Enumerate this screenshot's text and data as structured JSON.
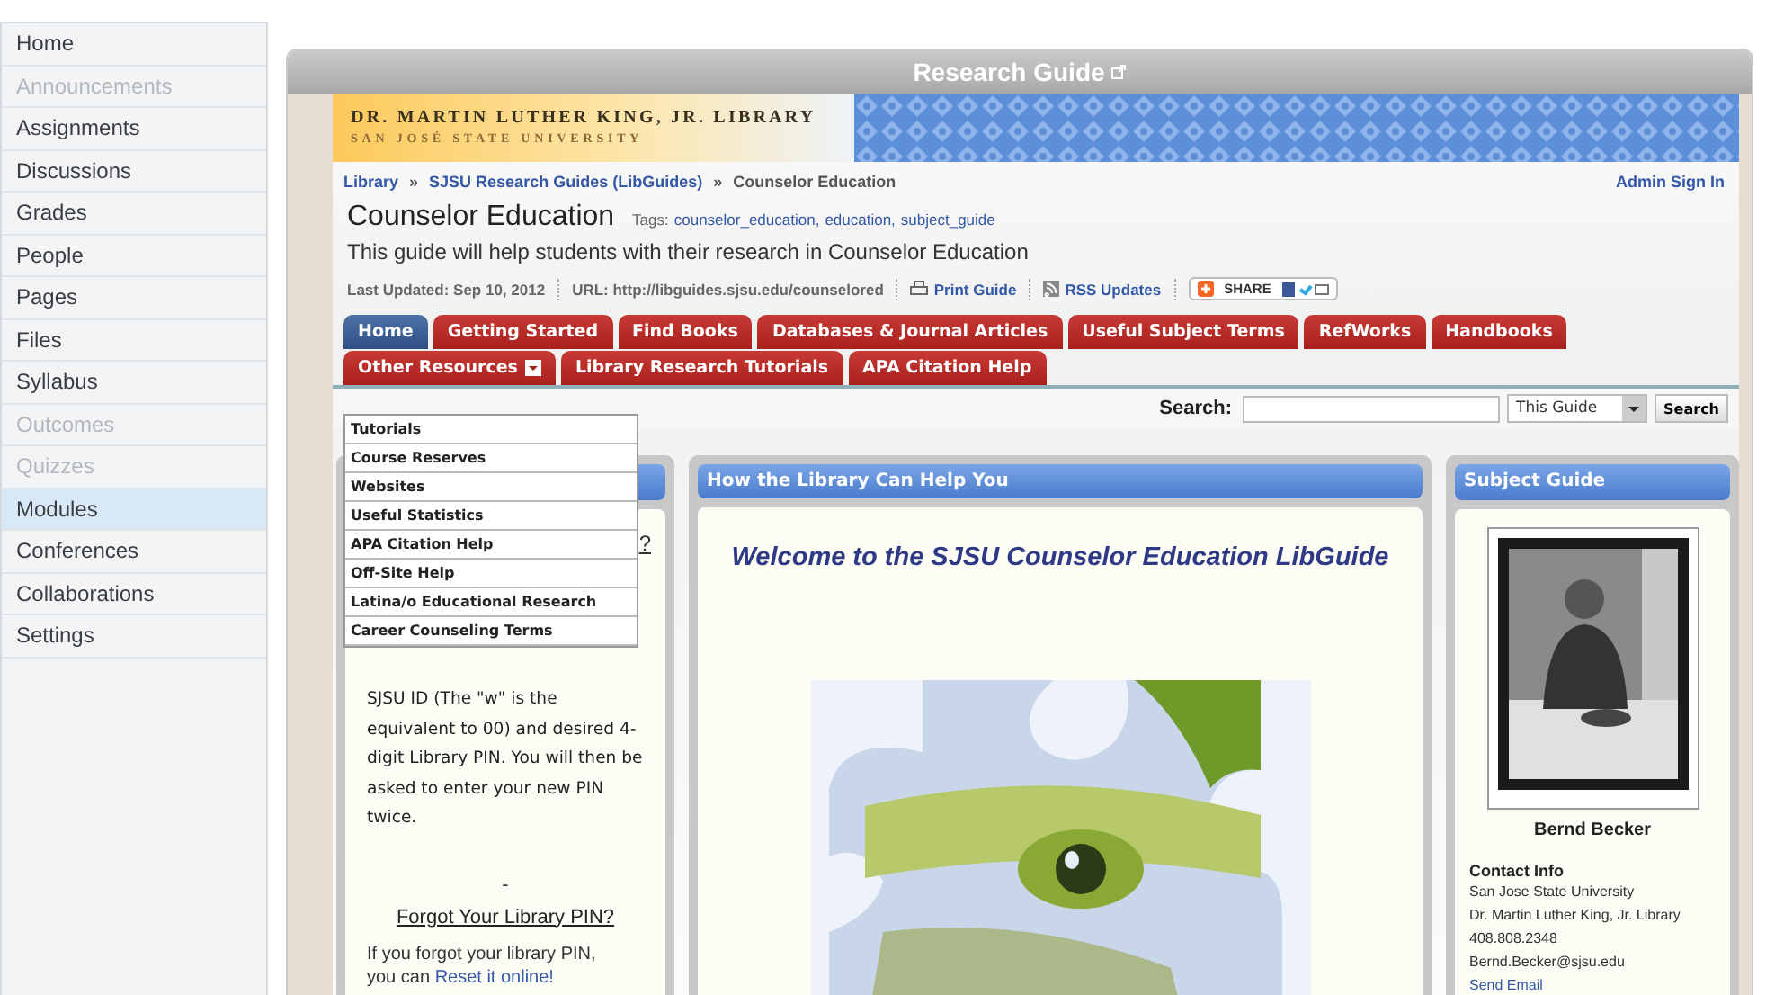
{
  "sidebar": {
    "items": [
      {
        "label": "Home",
        "disabled": false,
        "selected": false
      },
      {
        "label": "Announcements",
        "disabled": true,
        "selected": false
      },
      {
        "label": "Assignments",
        "disabled": false,
        "selected": false
      },
      {
        "label": "Discussions",
        "disabled": false,
        "selected": false
      },
      {
        "label": "Grades",
        "disabled": false,
        "selected": false
      },
      {
        "label": "People",
        "disabled": false,
        "selected": false
      },
      {
        "label": "Pages",
        "disabled": false,
        "selected": false
      },
      {
        "label": "Files",
        "disabled": false,
        "selected": false
      },
      {
        "label": "Syllabus",
        "disabled": false,
        "selected": false
      },
      {
        "label": "Outcomes",
        "disabled": true,
        "selected": false
      },
      {
        "label": "Quizzes",
        "disabled": true,
        "selected": false
      },
      {
        "label": "Modules",
        "disabled": false,
        "selected": true
      },
      {
        "label": "Conferences",
        "disabled": false,
        "selected": false
      },
      {
        "label": "Collaborations",
        "disabled": false,
        "selected": false
      },
      {
        "label": "Settings",
        "disabled": false,
        "selected": false
      }
    ]
  },
  "frame": {
    "title": "Research Guide"
  },
  "banner": {
    "title": "DR. MARTIN LUTHER KING, JR. LIBRARY",
    "subtitle": "SAN JOSÉ STATE UNIVERSITY"
  },
  "breadcrumb": {
    "links": [
      "Library",
      "SJSU Research Guides (LibGuides)"
    ],
    "separator": "»",
    "current": "Counselor Education",
    "admin": "Admin Sign In"
  },
  "guide": {
    "title": "Counselor Education",
    "tags_label": "Tags:",
    "tags": [
      "counselor_education,",
      "education,",
      "subject_guide"
    ],
    "description": "This guide will help students with their research in Counselor Education",
    "updated": "Last Updated: Sep 10, 2012",
    "url": "URL: http://libguides.sjsu.edu/counselored",
    "print": "Print Guide",
    "rss": "RSS Updates",
    "share": "SHARE"
  },
  "tabs_row1": [
    {
      "label": "Home",
      "selected": true
    },
    {
      "label": "Getting Started",
      "selected": false
    },
    {
      "label": "Find Books",
      "selected": false
    },
    {
      "label": "Databases & Journal Articles",
      "selected": false
    },
    {
      "label": "Useful Subject Terms",
      "selected": false
    },
    {
      "label": "RefWorks",
      "selected": false
    },
    {
      "label": "Handbooks",
      "selected": false
    }
  ],
  "tabs_row2": [
    {
      "label": "Other Resources",
      "selected": false,
      "expanded": true,
      "menu": [
        "Tutorials",
        "Course Reserves",
        "Websites",
        "Useful Statistics",
        "APA Citation Help",
        "Off-Site Help",
        "Latina/o Educational Research",
        "Career Counseling Terms"
      ]
    },
    {
      "label": "Library Research Tutorials",
      "selected": false
    },
    {
      "label": "APA Citation Help",
      "selected": false
    }
  ],
  "search": {
    "label": "Search:",
    "scope": "This Guide",
    "button": "Search"
  },
  "left_box": {
    "fragment": "?",
    "text": "SJSU ID (The \"w\" is the equivalent to 00) and desired 4-digit Library PIN. You will then be asked to enter your new PIN twice.",
    "dash": "-",
    "heading": "Forgot Your Library PIN?",
    "note": "If you forgot your library PIN, you can",
    "note_link": "Reset it online!"
  },
  "center_box": {
    "title": "How the Library Can Help You",
    "welcome": "Welcome to the SJSU Counselor Education LibGuide"
  },
  "right_box": {
    "title": "Subject Guide",
    "name": "Bernd Becker",
    "contact_title": "Contact Info",
    "contact_lines": [
      "San Jose State University",
      "Dr. Martin Luther King, Jr. Library",
      "408.808.2348",
      "Bernd.Becker@sjsu.edu"
    ],
    "send": "Send Email"
  }
}
